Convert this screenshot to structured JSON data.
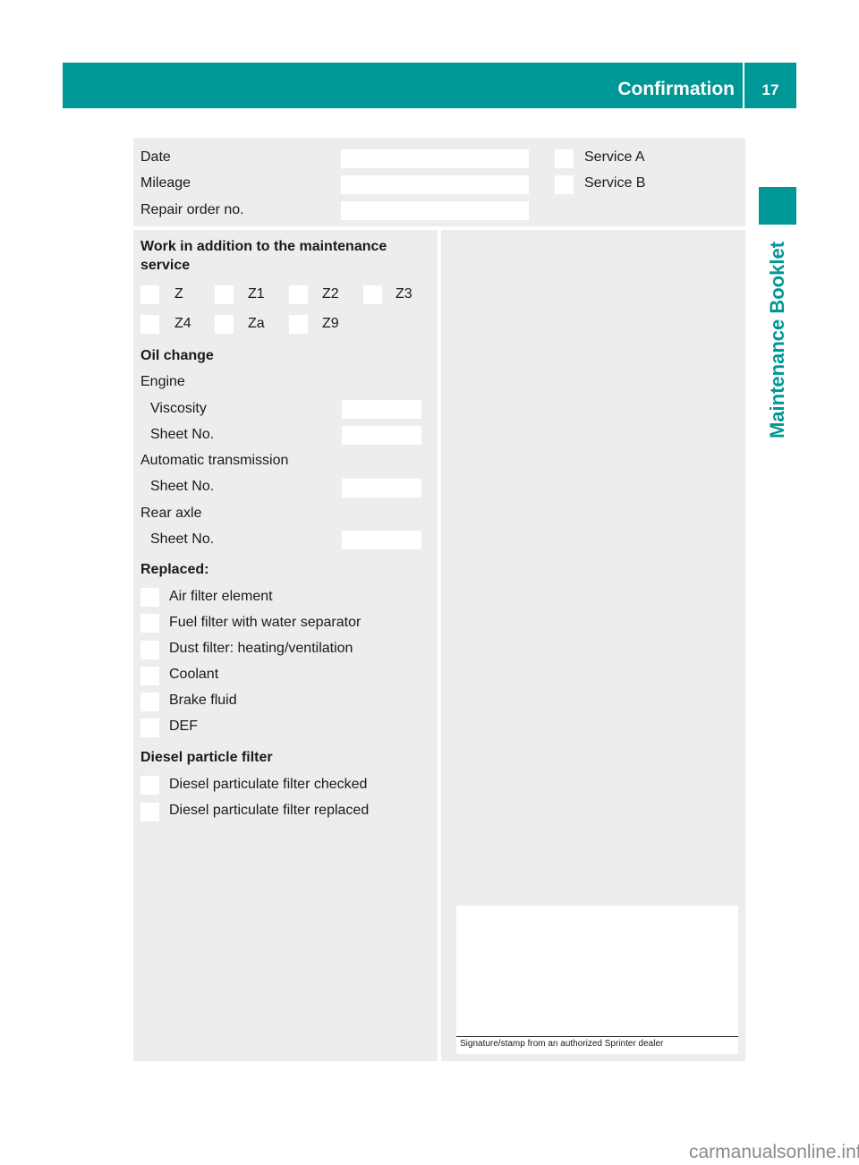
{
  "header": {
    "title": "Confirmation",
    "page_number": "17",
    "accent_color": "#009797"
  },
  "side_tab": {
    "label": "Maintenance Booklet"
  },
  "top_section": {
    "fields": [
      {
        "label": "Date",
        "value": ""
      },
      {
        "label": "Mileage",
        "value": ""
      },
      {
        "label": "Repair order no.",
        "value": ""
      }
    ],
    "services": [
      {
        "label": "Service A",
        "checked": false
      },
      {
        "label": "Service B",
        "checked": false
      }
    ]
  },
  "additional_work": {
    "heading_line1": "Work in addition to the maintenance",
    "heading_line2": "service",
    "options": [
      {
        "label": "Z",
        "checked": false
      },
      {
        "label": "Z1",
        "checked": false
      },
      {
        "label": "Z2",
        "checked": false
      },
      {
        "label": "Z3",
        "checked": false
      },
      {
        "label": "Z4",
        "checked": false
      },
      {
        "label": "Za",
        "checked": false
      },
      {
        "label": "Z9",
        "checked": false
      }
    ]
  },
  "oil_change": {
    "heading": "Oil change",
    "engine_label": "Engine",
    "viscosity_label": "Viscosity",
    "viscosity_value": "",
    "engine_sheet_label": "Sheet No.",
    "engine_sheet_value": "",
    "transmission_label": "Automatic transmission",
    "transmission_sheet_label": "Sheet No.",
    "transmission_sheet_value": "",
    "rear_axle_label": "Rear axle",
    "rear_axle_sheet_label": "Sheet No.",
    "rear_axle_sheet_value": ""
  },
  "replaced": {
    "heading": "Replaced:",
    "items": [
      {
        "label": "Air filter element",
        "checked": false
      },
      {
        "label": "Fuel filter with water separator",
        "checked": false
      },
      {
        "label": "Dust filter: heating/ventilation",
        "checked": false
      },
      {
        "label": "Coolant",
        "checked": false
      },
      {
        "label": "Brake fluid",
        "checked": false
      },
      {
        "label": "DEF",
        "checked": false
      }
    ]
  },
  "dpf": {
    "heading": "Diesel particle filter",
    "items": [
      {
        "label": "Diesel particulate filter checked",
        "checked": false
      },
      {
        "label": "Diesel particulate filter replaced",
        "checked": false
      }
    ]
  },
  "signature": {
    "caption": "Signature/stamp from an authorized Sprinter dealer"
  },
  "watermark": "carmanualsonline.info"
}
